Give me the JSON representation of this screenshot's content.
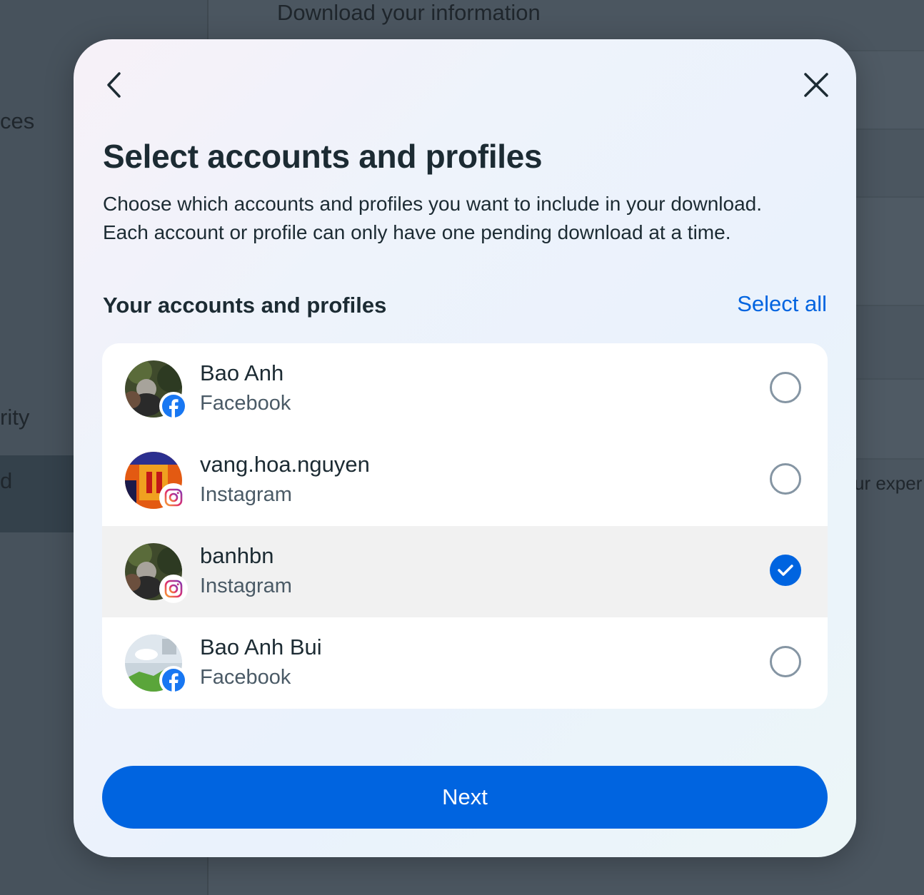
{
  "background": {
    "page_title": "Download your information",
    "sidebar_fragments": [
      "ces",
      "rity",
      "d"
    ],
    "right_fragment": "ur exper"
  },
  "modal": {
    "back_icon": "chevron-left-icon",
    "close_icon": "close-icon",
    "title": "Select accounts and profiles",
    "description": "Choose which accounts and profiles you want to include in your download. Each account or profile can only have one pending download at a time.",
    "section_heading": "Your accounts and profiles",
    "select_all_label": "Select all",
    "accounts": [
      {
        "name": "Bao Anh",
        "platform": "Facebook",
        "platform_icon": "facebook-icon",
        "selected": false
      },
      {
        "name": "vang.hoa.nguyen",
        "platform": "Instagram",
        "platform_icon": "instagram-icon",
        "selected": false
      },
      {
        "name": "banhbn",
        "platform": "Instagram",
        "platform_icon": "instagram-icon",
        "selected": true
      },
      {
        "name": "Bao Anh Bui",
        "platform": "Facebook",
        "platform_icon": "facebook-icon",
        "selected": false
      }
    ],
    "next_label": "Next"
  },
  "colors": {
    "accent": "#0064e0",
    "text_primary": "#1c2b33",
    "text_secondary": "#4a5a66",
    "selected_row": "#f1f1f1",
    "overlay": "#4b5660"
  }
}
